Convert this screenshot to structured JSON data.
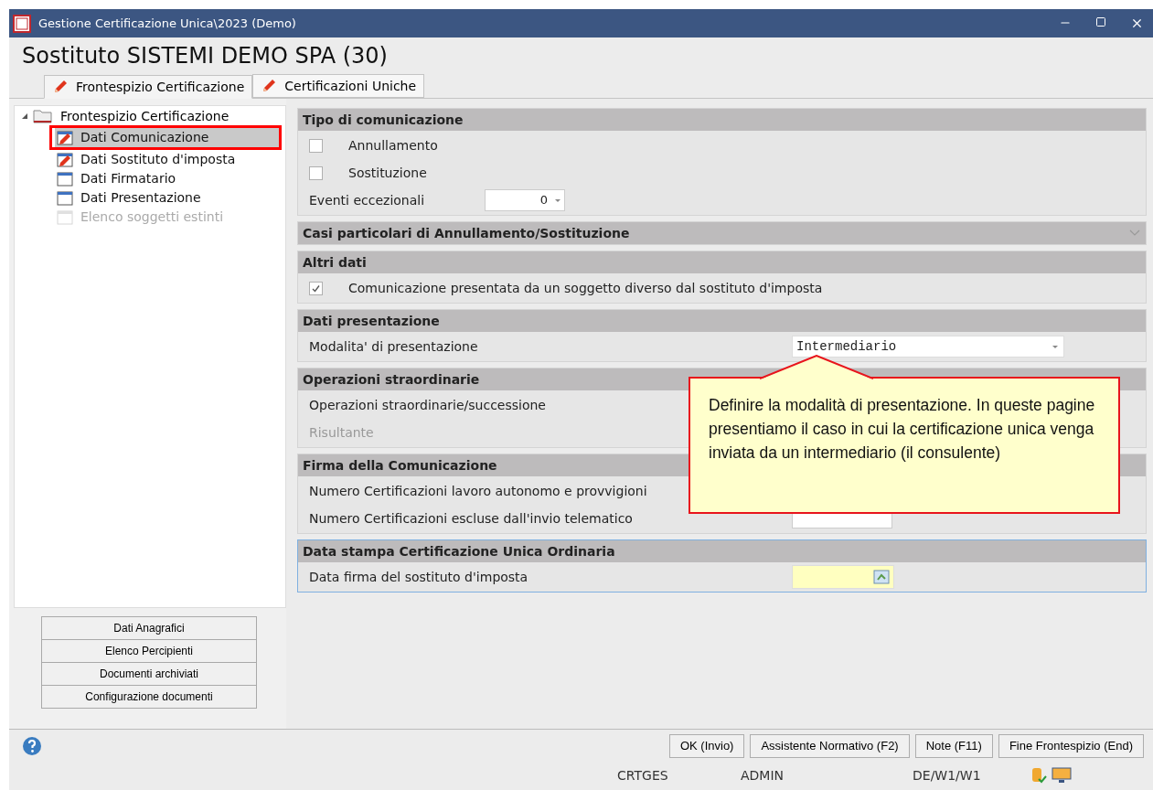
{
  "window": {
    "title": "Gestione Certificazione Unica\\2023  (Demo)"
  },
  "header": "Sostituto SISTEMI DEMO SPA (30)",
  "tabs": [
    {
      "label": "Frontespizio Certificazione",
      "selected": true
    },
    {
      "label": "Certificazioni Uniche",
      "selected": false
    }
  ],
  "tree": {
    "label": "Frontespizio Certificazione",
    "expanded": true,
    "children": [
      {
        "label": "Dati Comunicazione",
        "kind": "edited",
        "selected": true,
        "disabled": false,
        "annotated": true
      },
      {
        "label": "Dati Sostituto d'imposta",
        "kind": "edited",
        "selected": false,
        "disabled": false,
        "annotated": false
      },
      {
        "label": "Dati Firmatario",
        "kind": "form",
        "selected": false,
        "disabled": false,
        "annotated": false
      },
      {
        "label": "Dati Presentazione",
        "kind": "form",
        "selected": false,
        "disabled": false,
        "annotated": false
      },
      {
        "label": "Elenco soggetti estinti",
        "kind": "form",
        "selected": false,
        "disabled": true,
        "annotated": false
      }
    ]
  },
  "side_buttons": [
    "Dati Anagrafici",
    "Elenco Percipienti",
    "Documenti archiviati",
    "Configurazione documenti"
  ],
  "sections": [
    {
      "title": "Tipo di comunicazione",
      "collapsed": false,
      "focused": false,
      "rows": [
        {
          "kind": "checkbox",
          "label": "Annullamento",
          "checked": false
        },
        {
          "kind": "checkbox",
          "label": "Sostituzione",
          "checked": false
        },
        {
          "kind": "spin",
          "label": "Eventi eccezionali",
          "value": "0"
        }
      ]
    },
    {
      "title": "Casi particolari di Annullamento/Sostituzione",
      "collapsed": true,
      "focused": false
    },
    {
      "title": "Altri dati",
      "collapsed": false,
      "focused": false,
      "rows": [
        {
          "kind": "checkbox",
          "label": "Comunicazione presentata da un soggetto diverso dal sostituto d'imposta",
          "checked": true
        }
      ]
    },
    {
      "title": "Dati presentazione",
      "collapsed": false,
      "focused": false,
      "rows": [
        {
          "kind": "select",
          "label": "Modalita' di presentazione",
          "value": "Intermediario"
        }
      ]
    },
    {
      "title": "Operazioni straordinarie",
      "collapsed": false,
      "focused": false,
      "rows": [
        {
          "kind": "label",
          "label": "Operazioni straordinarie/successione",
          "disabled": false
        },
        {
          "kind": "label",
          "label": "Risultante",
          "disabled": true
        }
      ]
    },
    {
      "title": "Firma della Comunicazione",
      "collapsed": false,
      "focused": false,
      "rows": [
        {
          "kind": "label",
          "label": "Numero Certificazioni lavoro autonomo e provvigioni",
          "disabled": false
        },
        {
          "kind": "number",
          "label": "Numero Certificazioni escluse dall'invio telematico"
        }
      ]
    },
    {
      "title": "Data stampa Certificazione Unica Ordinaria",
      "collapsed": false,
      "focused": true,
      "rows": [
        {
          "kind": "date",
          "label": "Data firma del sostituto d'imposta"
        }
      ]
    }
  ],
  "callout": {
    "text": "Definire la modalità di presentazione. In queste pagine presentiamo il caso in cui la certificazione unica venga inviata da un intermediario (il consulente)"
  },
  "footer_buttons": [
    "OK (Invio)",
    "Assistente Normativo (F2)",
    "Note (F11)",
    "Fine Frontespizio (End)"
  ],
  "status_bar": [
    "CRTGES",
    "ADMIN",
    "DE/W1/W1"
  ]
}
